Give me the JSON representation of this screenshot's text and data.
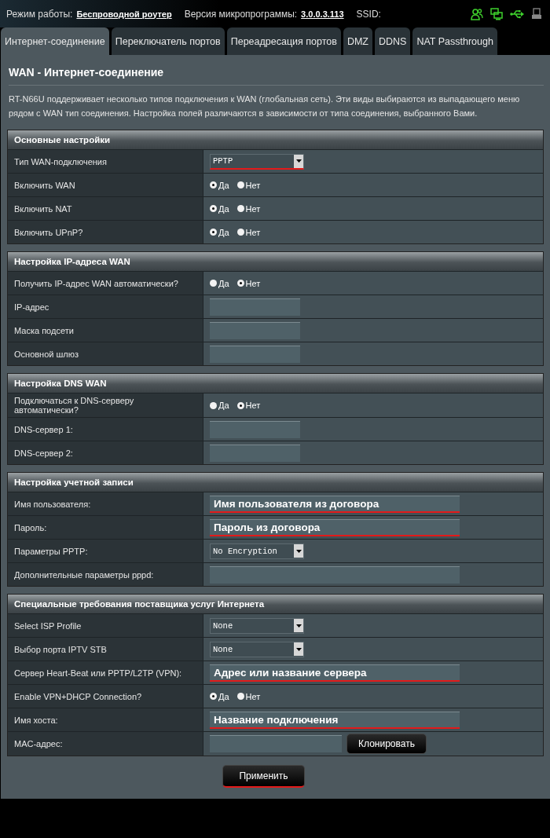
{
  "status_bar": {
    "mode_label": "Режим работы:",
    "mode_value": "Беспроводной роутер",
    "firmware_label": "Версия микропрограммы:",
    "firmware_value": "3.0.0.3.113",
    "ssid_label": "SSID:",
    "icons": [
      {
        "kind": "clients",
        "on": true
      },
      {
        "kind": "network",
        "on": true
      },
      {
        "kind": "usb",
        "on": true
      },
      {
        "kind": "printer",
        "on": false
      }
    ]
  },
  "tabs": [
    {
      "label": "Интернет-соединение",
      "selected": true
    },
    {
      "label": "Переключатель портов",
      "selected": false
    },
    {
      "label": "Переадресация портов",
      "selected": false
    },
    {
      "label": "DMZ",
      "selected": false
    },
    {
      "label": "DDNS",
      "selected": false
    },
    {
      "label": "NAT Passthrough",
      "selected": false
    }
  ],
  "page_title": "WAN - Интернет-соединение",
  "description": "RT-N66U поддерживает несколько типов подключения к WAN (глобальная сеть). Эти виды выбираются из выпадающего меню рядом с WAN тип соединения. Настройка полей различаются в зависимости от типа соединения, выбранного Вами.",
  "sections": [
    {
      "title": "Основные настройки",
      "rows": [
        {
          "label": "Тип WAN-подключения",
          "kind": "select",
          "value": "PPTP",
          "highlighted": true
        },
        {
          "label": "Включить WAN",
          "kind": "radio",
          "options": [
            {
              "label": "Да",
              "selected": true
            },
            {
              "label": "Нет",
              "selected": false
            }
          ]
        },
        {
          "label": "Включить NAT",
          "kind": "radio",
          "options": [
            {
              "label": "Да",
              "selected": true
            },
            {
              "label": "Нет",
              "selected": false
            }
          ]
        },
        {
          "label": "Включить UPnP?",
          "kind": "radio",
          "options": [
            {
              "label": "Да",
              "selected": true
            },
            {
              "label": "Нет",
              "selected": false
            }
          ]
        }
      ]
    },
    {
      "title": "Настройка IP-адреса WAN",
      "rows": [
        {
          "label": "Получить IP-адрес WAN автоматически?",
          "kind": "radio",
          "options": [
            {
              "label": "Да",
              "selected": false
            },
            {
              "label": "Нет",
              "selected": true
            }
          ]
        },
        {
          "label": "IP-адрес",
          "kind": "short_text",
          "highlighted": false
        },
        {
          "label": "Маска подсети",
          "kind": "short_text",
          "highlighted": false
        },
        {
          "label": "Основной шлюз",
          "kind": "short_text",
          "highlighted": false
        }
      ]
    },
    {
      "title": "Настройка DNS WAN",
      "rows": [
        {
          "label": "Подключаться к DNS-серверу автоматически?",
          "kind": "radio",
          "options": [
            {
              "label": "Да",
              "selected": false
            },
            {
              "label": "Нет",
              "selected": true
            }
          ]
        },
        {
          "label": "DNS-сервер 1:",
          "kind": "short_text",
          "highlighted": false
        },
        {
          "label": "DNS-сервер 2:",
          "kind": "short_text",
          "highlighted": false
        }
      ]
    },
    {
      "title": "Настройка учетной записи",
      "rows": [
        {
          "label": "Имя пользователя:",
          "kind": "long_text",
          "value": "Имя пользователя из договора",
          "highlighted": true
        },
        {
          "label": "Пароль:",
          "kind": "long_text",
          "value": "Пароль из договора",
          "highlighted": true
        },
        {
          "label": "Параметры PPTP:",
          "kind": "select",
          "value": "No Encryption",
          "highlighted": false
        },
        {
          "label": "Дополнительные параметры pppd:",
          "kind": "long_text",
          "highlighted": false
        }
      ]
    },
    {
      "title": "Специальные требования поставщика услуг Интернета",
      "rows": [
        {
          "label": "Select ISP Profile",
          "kind": "select",
          "value": "None",
          "highlighted": false
        },
        {
          "label": "Выбор порта IPTV STB",
          "kind": "select",
          "value": "None",
          "highlighted": false
        },
        {
          "label": "Сервер Heart-Beat или PPTP/L2TP (VPN):",
          "kind": "long_text",
          "value": "Адрес или название сервера",
          "highlighted": true
        },
        {
          "label": "Enable VPN+DHCP Connection?",
          "kind": "radio",
          "options": [
            {
              "label": "Да",
              "selected": true
            },
            {
              "label": "Нет",
              "selected": false
            }
          ]
        },
        {
          "label": "Имя хоста:",
          "kind": "long_text",
          "value": "Название подключения",
          "highlighted": true
        },
        {
          "label": "MAC-адрес:",
          "kind": "text_button",
          "button": "Клонировать",
          "highlighted": false
        }
      ]
    }
  ],
  "apply_button": {
    "label": "Применить",
    "highlighted": true
  }
}
